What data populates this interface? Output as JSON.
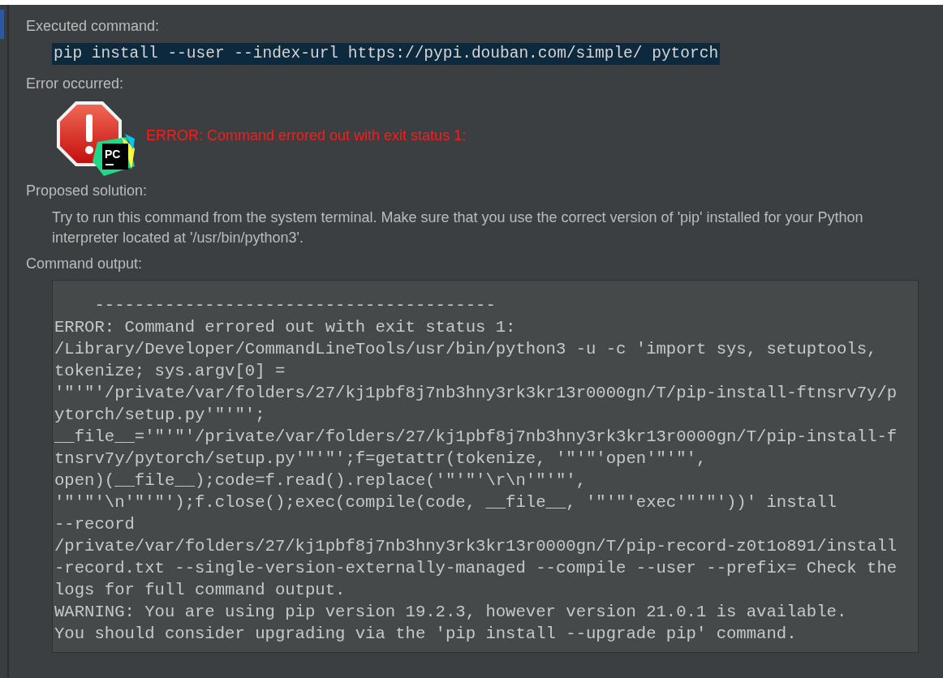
{
  "executed_command": {
    "label": "Executed command:",
    "command": "pip install --user --index-url https://pypi.douban.com/simple/ pytorch"
  },
  "error": {
    "label": "Error occurred:",
    "badge_text": "PC",
    "message": "ERROR: Command errored out with exit status 1:"
  },
  "proposed_solution": {
    "label": "Proposed solution:",
    "text": "Try to run this command from the system terminal. Make sure that you use the correct version of 'pip' installed for your Python interpreter located at '/usr/bin/python3'."
  },
  "command_output": {
    "label": "Command output:",
    "lines": [
      "    ----------------------------------------",
      "ERROR: Command errored out with exit status 1:",
      "/Library/Developer/CommandLineTools/usr/bin/python3 -u -c 'import sys, setuptools,",
      "tokenize; sys.argv[0] =",
      "'\"'\"'/private/var/folders/27/kj1pbf8j7nb3hny3rk3kr13r0000gn/T/pip-install-ftnsrv7y/p",
      "ytorch/setup.py'\"'\"';",
      "__file__='\"'\"'/private/var/folders/27/kj1pbf8j7nb3hny3rk3kr13r0000gn/T/pip-install-f",
      "tnsrv7y/pytorch/setup.py'\"'\"';f=getattr(tokenize, '\"'\"'open'\"'\"',",
      "open)(__file__);code=f.read().replace('\"'\"'\\r\\n'\"'\"',",
      "'\"'\"'\\n'\"'\"');f.close();exec(compile(code, __file__, '\"'\"'exec'\"'\"'))' install",
      "--record",
      "/private/var/folders/27/kj1pbf8j7nb3hny3rk3kr13r0000gn/T/pip-record-z0t1o891/install",
      "-record.txt --single-version-externally-managed --compile --user --prefix= Check the",
      "logs for full command output.",
      "WARNING: You are using pip version 19.2.3, however version 21.0.1 is available.",
      "You should consider upgrading via the 'pip install --upgrade pip' command."
    ]
  }
}
